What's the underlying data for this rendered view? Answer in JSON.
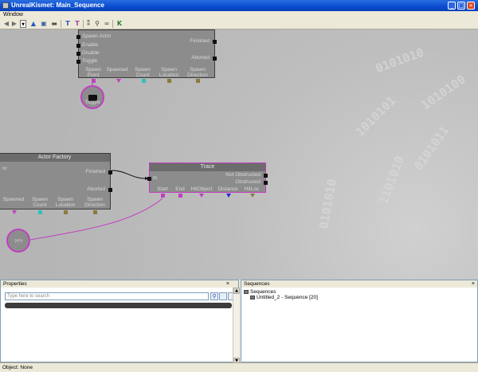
{
  "window": {
    "title": "UnrealKismet: Main_Sequence"
  },
  "menu": {
    "items": [
      "Window"
    ]
  },
  "toolbar": {
    "icons": [
      "back-arrow",
      "forward-arrow",
      "dropdown",
      "up-arrow",
      "parent-sequence",
      "screenshot",
      "tree-T-blue",
      "tree-T-purple",
      "walk",
      "zoom",
      "link",
      "k-search"
    ]
  },
  "canvas": {
    "top_node": {
      "inputs": [
        "Spawn Actor",
        "Enable",
        "Disable",
        "Toggle"
      ],
      "outputs": [
        "Finished",
        "Aborted"
      ],
      "vars": [
        "Spawn Point",
        "Spawned",
        "Spawn Count",
        "Spawn Location",
        "Spawn Direction"
      ]
    },
    "toggle_circle": "Toggle",
    "factory_node": {
      "title": "Actor Factory",
      "left_text": "or",
      "outputs": [
        "Finished",
        "Aborted"
      ],
      "vars": [
        "Spawned",
        "Spawn Count",
        "Spawn Location",
        "Spawn Direction"
      ]
    },
    "trace_node": {
      "title": "Trace",
      "input": "In",
      "outputs": [
        "Not Obstructed",
        "Obstructed"
      ],
      "vars": [
        "Start",
        "End",
        "HitObject",
        "Distance",
        "HitLoc"
      ]
    },
    "unknown_circle": "???",
    "background_binary": [
      "0101010",
      "1010101",
      "0101010",
      "1101010",
      "0101011",
      "1010100"
    ]
  },
  "properties_panel": {
    "title": "Properties",
    "search_placeholder": "Type here to search"
  },
  "sequences_panel": {
    "title": "Sequences",
    "root": "Sequences",
    "child": "Untitled_2 - Sequence [20]"
  },
  "status": {
    "text": "Object: None"
  },
  "colors": {
    "titlebar": "#0a4bcf",
    "link_magenta": "#c040c0",
    "canvas": "#bebebe",
    "node": "#8c8c8c"
  }
}
